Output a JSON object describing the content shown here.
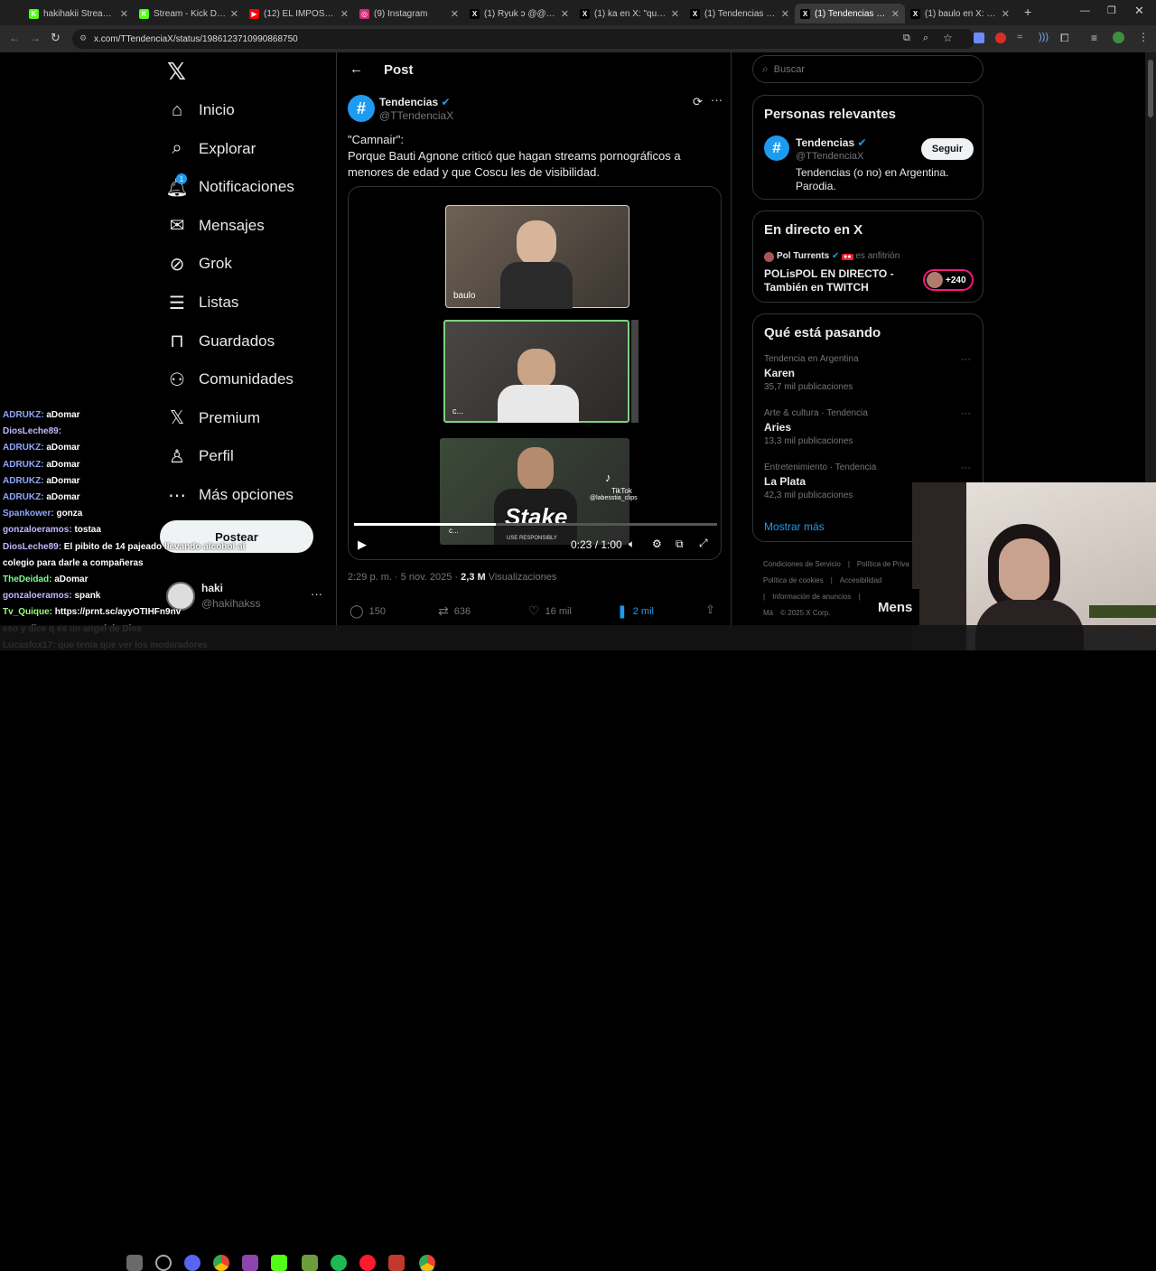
{
  "tabs": [
    {
      "title": "hakihakii Stream - W",
      "color": "#53fc18",
      "glyph": "K",
      "active": false
    },
    {
      "title": "Stream - Kick Dashbo",
      "color": "#53fc18",
      "glyph": "K",
      "active": false
    },
    {
      "title": "(12) EL IMPOSTOR de",
      "color": "#ff0000",
      "glyph": "▶",
      "active": false
    },
    {
      "title": "(9) Instagram",
      "color": "#d62976",
      "glyph": "◎",
      "active": false
    },
    {
      "title": "(1) Ryuk ↄ @@ en X",
      "color": "#000",
      "glyph": "X",
      "active": false
    },
    {
      "title": "(1) ka en X: \"que una",
      "color": "#000",
      "glyph": "X",
      "active": false
    },
    {
      "title": "(1) Tendencias en X: ",
      "color": "#000",
      "glyph": "X",
      "active": false
    },
    {
      "title": "(1) Tendencias en X: ",
      "color": "#000",
      "glyph": "X",
      "active": true
    },
    {
      "title": "(1) baulo en X: \"arrog",
      "color": "#000",
      "glyph": "X",
      "active": false
    }
  ],
  "browser": {
    "url": "x.com/TTendenciaX/status/1986123710990868750"
  },
  "nav": {
    "logo": "𝕏",
    "items": [
      {
        "label": "Inicio",
        "icon": "home-icon"
      },
      {
        "label": "Explorar",
        "icon": "search-icon"
      },
      {
        "label": "Notificaciones",
        "icon": "bell-icon",
        "badge": "1"
      },
      {
        "label": "Mensajes",
        "icon": "mail-icon"
      },
      {
        "label": "Grok",
        "icon": "grok-icon"
      },
      {
        "label": "Listas",
        "icon": "list-icon"
      },
      {
        "label": "Guardados",
        "icon": "bookmark-icon"
      },
      {
        "label": "Comunidades",
        "icon": "communities-icon"
      },
      {
        "label": "Premium",
        "icon": "x-icon"
      },
      {
        "label": "Perfil",
        "icon": "person-icon"
      },
      {
        "label": "Más opciones",
        "icon": "more-circle-icon"
      }
    ],
    "post_button": "Postear",
    "account": {
      "name": "haki",
      "handle": "@hakihakss"
    }
  },
  "post": {
    "header": "Post",
    "author": "Tendencias",
    "handle": "@TTendenciaX",
    "text_line1": "\"Camnair\":",
    "text_line2": "Porque Bauti Agnone criticó que hagan streams pornográficos a menores de edad y que Coscu les de visibilidad.",
    "video": {
      "label_top": "baulo",
      "label_mid": "c...",
      "label_bot": "c...",
      "tiktok": "TikTok",
      "tiktok_user": "@labesstia_clips",
      "stake": "Stake",
      "stake_sub": "USE RESPONSIBLY",
      "time": "0:23 / 1:00",
      "progress": 0.39
    },
    "date": "2:29 p. m. · 5 nov. 2025 · ",
    "views_count": "2,3 M",
    "views_label": " Visualizaciones",
    "replies": "150",
    "reposts": "636",
    "likes": "16 mil",
    "bookmarks": "2 mil"
  },
  "right": {
    "search_placeholder": "Buscar",
    "relevant": {
      "title": "Personas relevantes",
      "name": "Tendencias",
      "handle": "@TTendenciaX",
      "bio": "Tendencias (o no) en Argentina. Parodia.",
      "follow": "Seguir"
    },
    "live": {
      "title": "En directo en X",
      "host": "Pol Turrents",
      "host_suffix": "es anfitrión",
      "event": "POLisPOL EN DIRECTO - También en TWITCH",
      "count": "+240"
    },
    "happening": {
      "title": "Qué está pasando",
      "trends": [
        {
          "category": "Tendencia en Argentina",
          "name": "Karen",
          "count": "35,7 mil publicaciones"
        },
        {
          "category": "Arte & cultura · Tendencia",
          "name": "Aries",
          "count": "13,3 mil publicaciones"
        },
        {
          "category": "Entretenimiento · Tendencia",
          "name": "La Plata",
          "count": "42,3 mil publicaciones"
        }
      ],
      "show_more": "Mostrar más"
    },
    "footer": [
      "Condiciones de Servicio",
      "|",
      "Política de Priva",
      "Política de cookies",
      "|",
      "Accesibilidad",
      "|",
      "Información de anuncios",
      "|",
      "Má",
      "© 2025 X Corp."
    ]
  },
  "messages_label": "Mens",
  "chat": [
    {
      "user": "ADRUKZ:",
      "msg": " aDomar",
      "color": "#8fa7ff"
    },
    {
      "user": "DiosLeche89:",
      "msg": "",
      "color": "#c2b6ff"
    },
    {
      "user": "ADRUKZ:",
      "msg": " aDomar",
      "color": "#8fa7ff"
    },
    {
      "user": "ADRUKZ:",
      "msg": " aDomar",
      "color": "#8fa7ff"
    },
    {
      "user": "ADRUKZ:",
      "msg": " aDomar",
      "color": "#8fa7ff"
    },
    {
      "user": "ADRUKZ:",
      "msg": " aDomar",
      "color": "#8fa7ff"
    },
    {
      "user": "Spankower:",
      "msg": " gonza",
      "color": "#8fa7ff"
    },
    {
      "user": "gonzaloeramos:",
      "msg": " tostaa",
      "color": "#c2b6ff"
    },
    {
      "user": "DiosLeche89:",
      "msg": " El pibito de 14 pajeado llevando alcohol al",
      "color": "#c2b6ff"
    },
    {
      "user": "",
      "msg": "colegio para darle a  compañeras",
      "color": "#fff"
    },
    {
      "user": "TheDeidad:",
      "msg": " aDomar",
      "color": "#7dff8a"
    },
    {
      "user": "gonzaloeramos:",
      "msg": " spank",
      "color": "#c2b6ff"
    },
    {
      "user": "Tv_Quique:",
      "msg": " https://prnt.sc/ayyOTIHFn9nv",
      "color": "#9dff7a"
    },
    {
      "user": "",
      "msg": "eso y dice q es un angel de Dios",
      "color": "#fff"
    },
    {
      "user": "Lucasfox17:",
      "msg": " que tenia que ver los moderadores",
      "color": "#fff"
    }
  ],
  "colors": {
    "accent": "#1d9bf0",
    "bg": "#000000",
    "border": "#2f3336",
    "muted": "#71767b"
  }
}
